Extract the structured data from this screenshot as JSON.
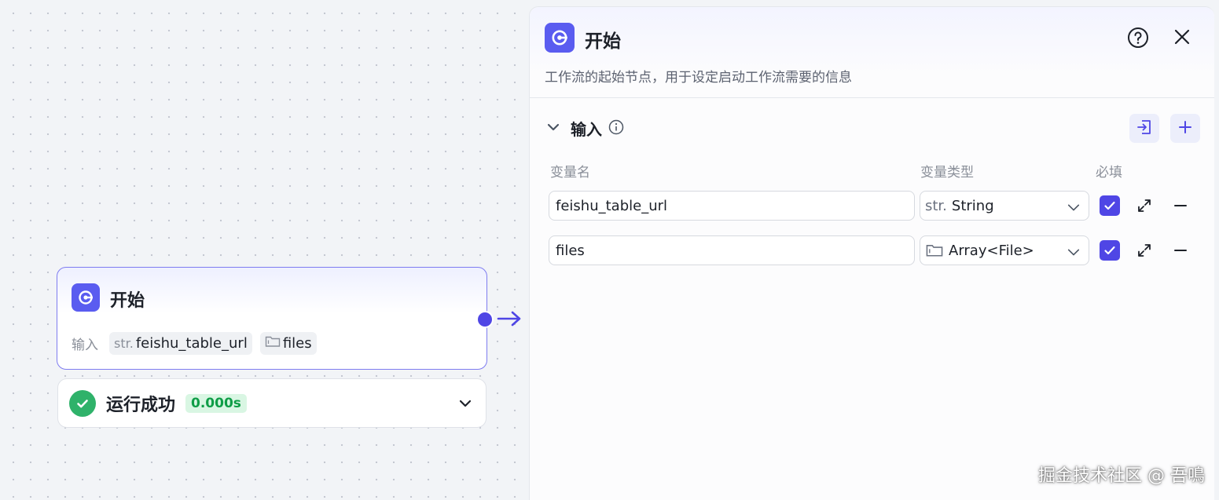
{
  "canvas_node": {
    "title": "开始",
    "inputs_label": "输入",
    "inputs": [
      {
        "type": "str.",
        "name": "feishu_table_url"
      },
      {
        "type_icon": "folder-icon",
        "name": "files"
      }
    ]
  },
  "run_status": {
    "text": "运行成功",
    "duration": "0.000s"
  },
  "panel": {
    "title": "开始",
    "description": "工作流的起始节点，用于设定启动工作流需要的信息",
    "section_title": "输入",
    "columns": {
      "name": "变量名",
      "type": "变量类型",
      "required": "必填"
    },
    "variables": [
      {
        "name": "feishu_table_url",
        "type_prefix": "str.",
        "type": "String",
        "required": true
      },
      {
        "name": "files",
        "type_icon": "folder-icon",
        "type": "Array<File>",
        "required": true
      }
    ]
  },
  "watermark": "掘金技术社区 @ 吾鳴",
  "colors": {
    "accent": "#5a5cf0",
    "success": "#2fb26a",
    "checkbox": "#4f46e5"
  }
}
